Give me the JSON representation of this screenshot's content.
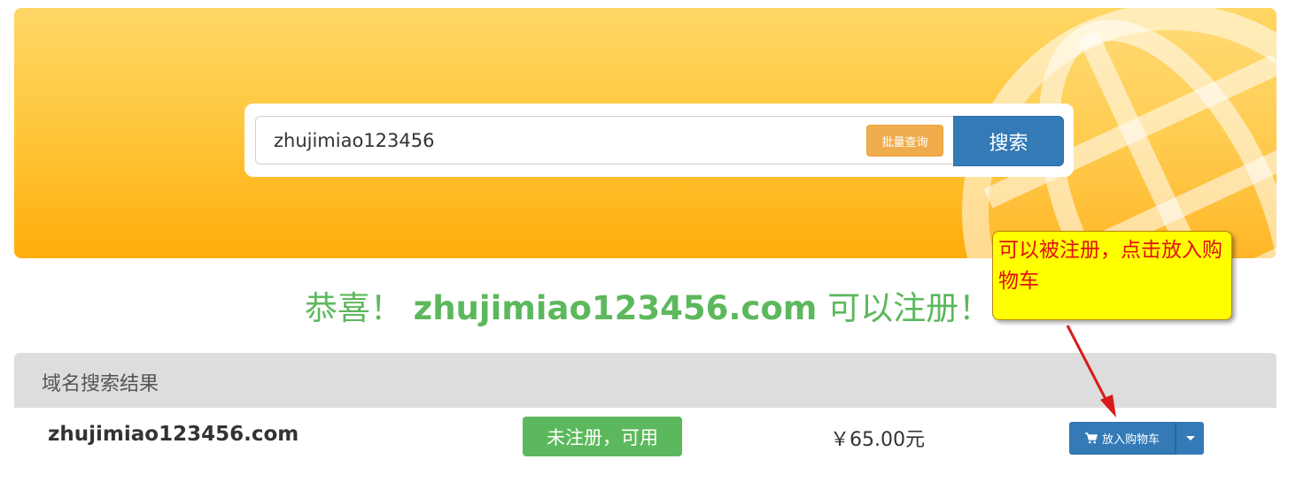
{
  "search": {
    "value": "zhujimiao123456",
    "batch_label": "批量查询",
    "button_label": "搜索"
  },
  "result_message": {
    "prefix": "恭喜！ ",
    "domain": "zhujimiao123456.com",
    "suffix": " 可以注册！"
  },
  "results": {
    "header": "域名搜索结果",
    "rows": [
      {
        "domain": "zhujimiao123456.com",
        "status": "未注册，可用",
        "price": "￥65.00元",
        "cart_label": "放入购物车"
      }
    ]
  },
  "annotation": {
    "text": "可以被注册，点击放入购物车"
  },
  "colors": {
    "banner_top": "#ffd766",
    "banner_bottom": "#ffad0a",
    "primary": "#337ab7",
    "success": "#5cb85c",
    "warning": "#f0ad4e",
    "callout": "#ffff00",
    "callout_text": "#e01010"
  },
  "icons": {
    "globe": "globe-icon",
    "cart": "shopping-cart-icon",
    "dropdown": "caret-down-icon"
  }
}
